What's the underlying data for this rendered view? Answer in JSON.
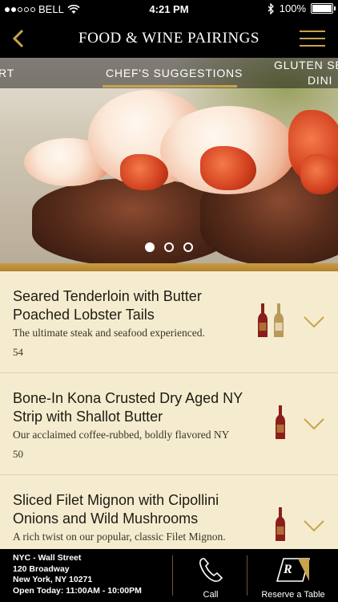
{
  "status_bar": {
    "carrier": "BELL",
    "time": "4:21 PM",
    "battery": "100%"
  },
  "header": {
    "title": "FOOD & WINE PAIRINGS",
    "back_icon": "chevron-left-icon",
    "menu_icon": "hamburger-icon"
  },
  "tabs": [
    {
      "label": "RT",
      "active": false
    },
    {
      "label": "CHEF'S SUGGESTIONS",
      "active": true
    },
    {
      "label_line1": "GLUTEN SE",
      "label_line2": "DINI",
      "active": false
    }
  ],
  "carousel": {
    "page_count": 3,
    "active_page": 1
  },
  "items": [
    {
      "name": "Seared Tenderloin with Butter Poached Lobster Tails",
      "description": "The ultimate steak and seafood experienced.",
      "price": "54",
      "wines": [
        "red",
        "white"
      ]
    },
    {
      "name": "Bone-In Kona Crusted Dry Aged NY Strip with Shallot Butter",
      "description": "Our acclaimed coffee-rubbed, boldly flavored NY",
      "price": "50",
      "wines": [
        "red"
      ]
    },
    {
      "name": "Sliced Filet Mignon with Cipollini Onions and Wild Mushrooms",
      "description": "A rich twist on our popular, classic Filet Mignon.",
      "price": "",
      "wines": [
        "red"
      ]
    }
  ],
  "footer": {
    "address_line1": "NYC - Wall Street",
    "address_line2": "120 Broadway",
    "address_line3": "New York, NY 10271",
    "address_line4": "Open Today: 11:00AM - 10:00PM",
    "call_label": "Call",
    "reserve_label": "Reserve a Table",
    "reserve_letter": "R"
  },
  "colors": {
    "gold": "#c9a34a",
    "cream": "#f5ecd0",
    "red_wine": "#8b1e1a",
    "white_wine": "#b9995a"
  }
}
